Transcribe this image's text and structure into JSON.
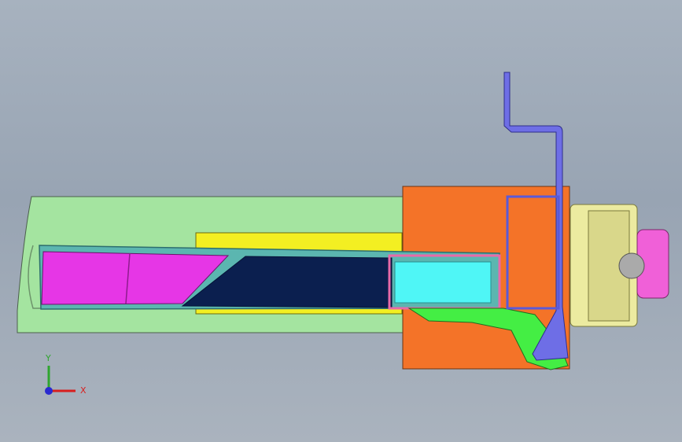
{
  "viewport": {
    "background_top": "#a7b2bf",
    "background_bottom": "#aab3be"
  },
  "axes": {
    "x_label": "X",
    "y_label": "Y",
    "x_color": "#d81e1e",
    "y_color": "#2fa52f",
    "z_color": "#2a2ad0"
  },
  "parts": {
    "housing_color": "#a4e4a0",
    "slider_color": "#f3ef22",
    "block_color": "#f47328",
    "cutter_color": "#e636e6",
    "core_color": "#0b1f4f",
    "window_color": "#4ff6f6",
    "rod_color": "#6e6ee6",
    "lever_color": "#44ee44",
    "hub_color": "#eceba0",
    "knob_color": "#f060d8",
    "ball_color": "#aaaaaa"
  }
}
